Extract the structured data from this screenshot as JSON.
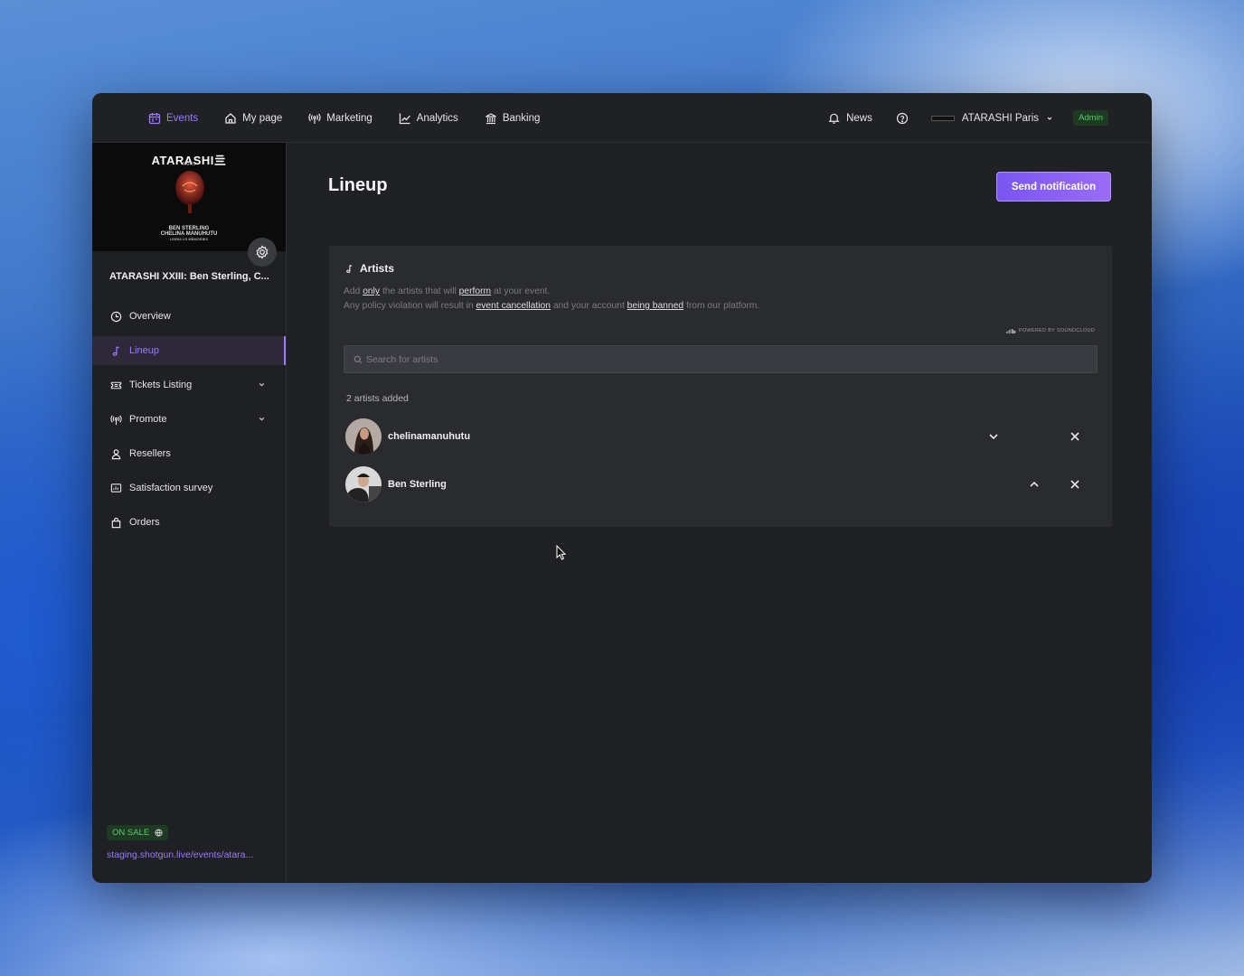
{
  "topnav": {
    "items": [
      {
        "label": "Events",
        "icon": "calendar-icon",
        "active": true
      },
      {
        "label": "My page",
        "icon": "home-icon"
      },
      {
        "label": "Marketing",
        "icon": "broadcast-icon"
      },
      {
        "label": "Analytics",
        "icon": "chart-icon"
      },
      {
        "label": "Banking",
        "icon": "bank-icon"
      }
    ],
    "news_label": "News",
    "org_name": "ATARASHI Paris",
    "org_logo_text": "ATARASHI",
    "admin_badge": "Admin"
  },
  "event": {
    "cover_brand": "ATARASHI亖",
    "cover_sub": "PARIS",
    "cover_names": [
      "BEN STERLING",
      "CHELINA MANUHUTU",
      "LEIRIA VS MEMORIES"
    ],
    "title": "ATARASHI XXIII: Ben Sterling, C...",
    "status": "ON SALE",
    "link": "staging.shotgun.live/events/atara..."
  },
  "sidebar": {
    "items": [
      {
        "label": "Overview",
        "icon": "clock-icon"
      },
      {
        "label": "Lineup",
        "icon": "music-note-icon",
        "active": true
      },
      {
        "label": "Tickets Listing",
        "icon": "ticket-icon",
        "expandable": true
      },
      {
        "label": "Promote",
        "icon": "broadcast-icon",
        "expandable": true
      },
      {
        "label": "Resellers",
        "icon": "user-icon"
      },
      {
        "label": "Satisfaction survey",
        "icon": "survey-icon"
      },
      {
        "label": "Orders",
        "icon": "bag-icon"
      }
    ]
  },
  "main": {
    "title": "Lineup",
    "send_button": "Send notification",
    "card": {
      "heading": "Artists",
      "desc": {
        "p1": "Add ",
        "u1": "only",
        "p2": " the artists that will ",
        "u2": "perform",
        "p3": " at your event.",
        "p4": "Any policy violation will result in ",
        "u3": "event cancellation",
        "p5": " and your account ",
        "u4": "being banned",
        "p6": " from our platform."
      },
      "powered_by": "POWERED BY SOUNDCLOUD",
      "search_placeholder": "Search for artists",
      "count_label": "2 artists added",
      "artists": [
        {
          "name": "chelinamanuhutu"
        },
        {
          "name": "Ben Sterling"
        }
      ]
    }
  },
  "colors": {
    "accent": "#9c7bff",
    "on_sale": "#56c96a",
    "window_bg": "#202124",
    "card_bg": "#2a2b2f"
  }
}
